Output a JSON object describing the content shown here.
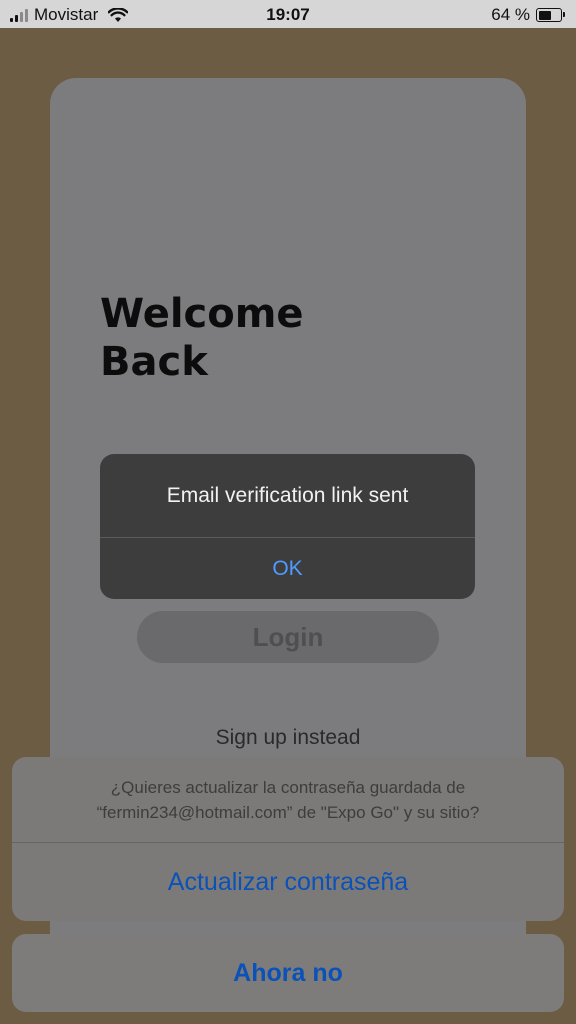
{
  "status_bar": {
    "carrier": "Movistar",
    "time": "19:07",
    "battery_percent": "64 %",
    "battery_level": 0.64,
    "signal_bars": 2
  },
  "screen": {
    "welcome_title": "Welcome\nBack",
    "login_button": "Login",
    "signup_link": "Sign up instead"
  },
  "alert": {
    "message": "Email verification link sent",
    "ok_button": "OK"
  },
  "password_sheet": {
    "message_line1": "¿Quieres actualizar la contraseña guardada de",
    "message_line2": "“fermin234@hotmail.com” de \"Expo Go\" y su sitio?",
    "update_button": "Actualizar contraseña",
    "cancel_button": "Ahora no"
  },
  "colors": {
    "link_blue": "#0a52b8",
    "alert_ok_blue": "#4f9bff"
  }
}
